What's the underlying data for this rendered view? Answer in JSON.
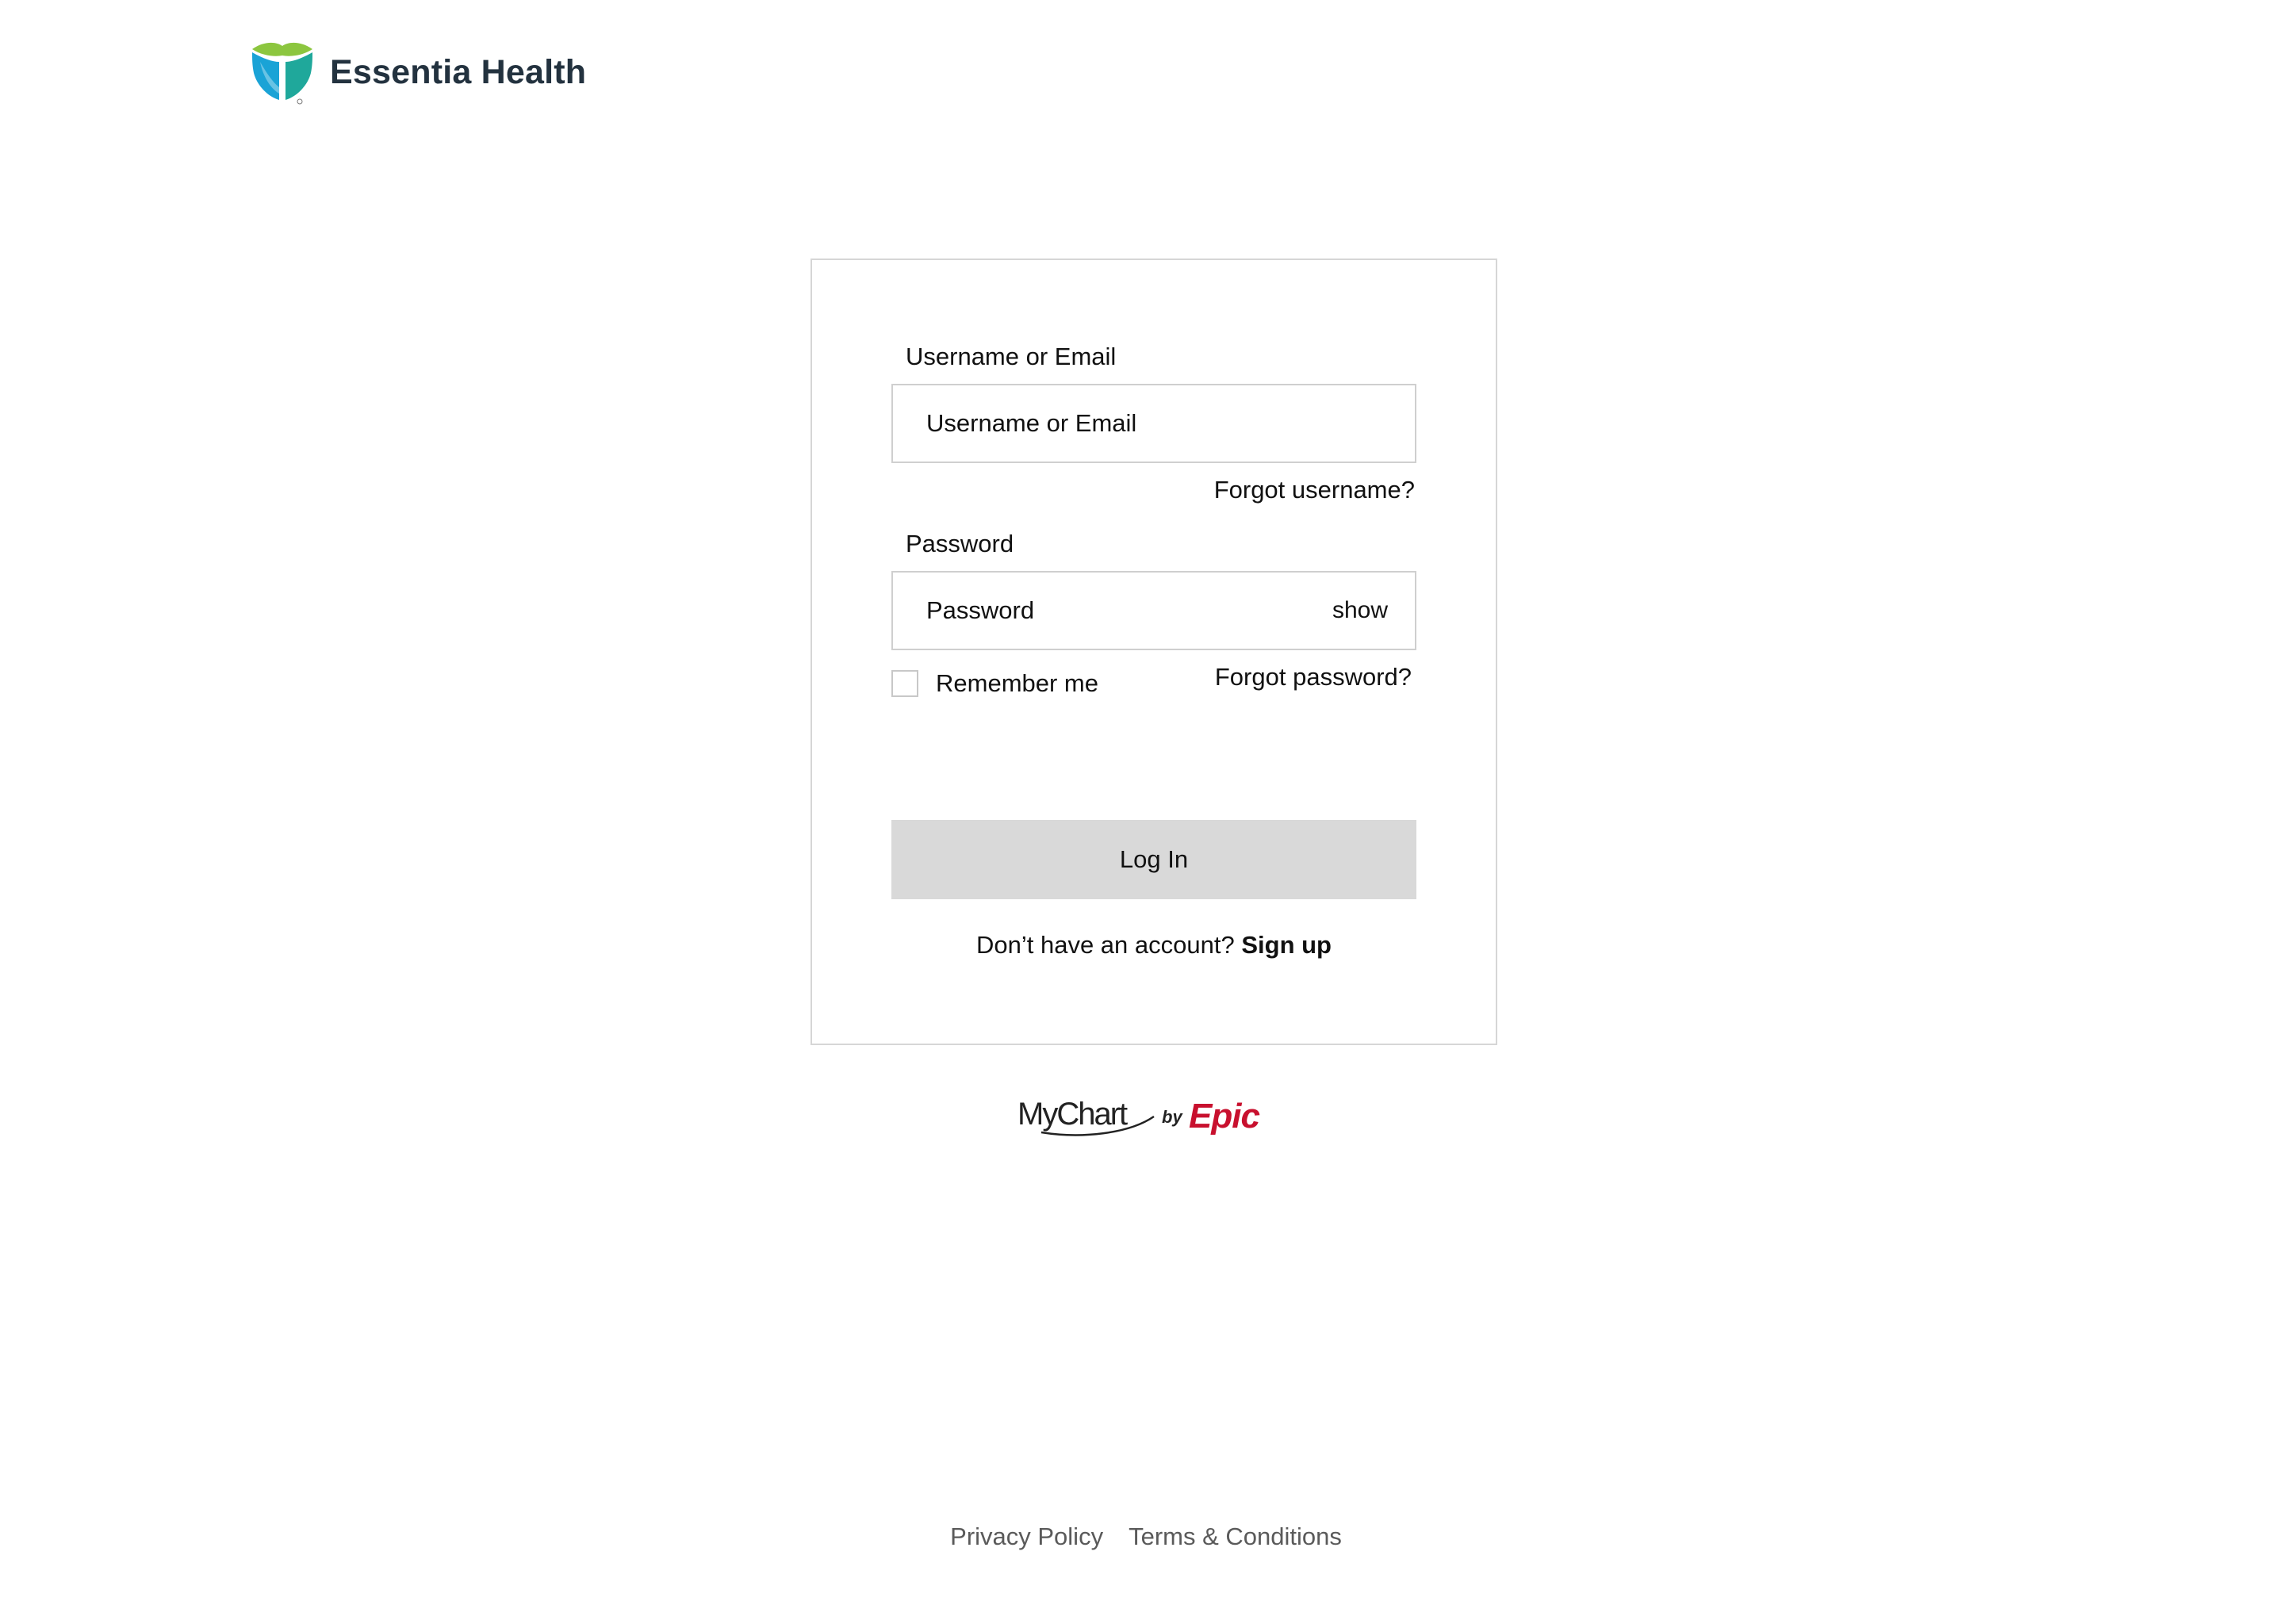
{
  "brand": {
    "name": "Essentia Health",
    "icon": "essentia-health-logo-icon",
    "colors": {
      "lime": "#8cc63f",
      "blue": "#1aa3d6",
      "teal": "#1fa89b",
      "text": "#23323f"
    }
  },
  "login": {
    "username_label": "Username or Email",
    "username_placeholder": "Username or Email",
    "username_value": "",
    "forgot_username": "Forgot username?",
    "password_label": "Password",
    "password_placeholder": "Password",
    "password_value": "",
    "show_label": "show",
    "remember_label": "Remember me",
    "remember_checked": false,
    "forgot_password": "Forgot password?",
    "login_button": "Log In",
    "signup_prompt": "Don’t have an account?",
    "signup_link": "Sign up",
    "button_color": "#d9d9d9"
  },
  "mychart": {
    "logo_text": "MyChart by Epic",
    "epic_color": "#c8102e"
  },
  "footer": {
    "privacy": "Privacy Policy",
    "terms": "Terms & Conditions"
  }
}
